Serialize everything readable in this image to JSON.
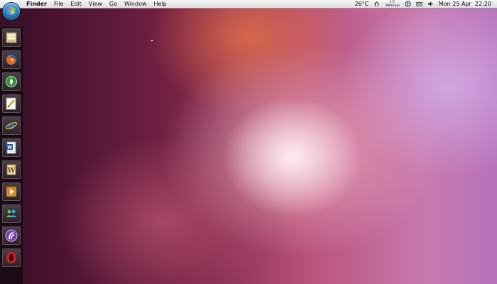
{
  "menubar": {
    "app_name": "Finder",
    "menus": [
      "File",
      "Edit",
      "View",
      "Go",
      "Window",
      "Help"
    ],
    "temperature": "26°C",
    "net_up": "1°C",
    "net_down": "3800rpm",
    "datetime": "Mon 25 Apr  22:20"
  },
  "dock": {
    "items": [
      {
        "icon": "start-orb-icon"
      },
      {
        "icon": "file-manager-icon"
      },
      {
        "icon": "firefox-icon"
      },
      {
        "icon": "green-app-icon"
      },
      {
        "icon": "text-editor-icon"
      },
      {
        "icon": "internet-explorer-icon"
      },
      {
        "icon": "word-document-icon"
      },
      {
        "icon": "wordpad-icon"
      },
      {
        "icon": "media-player-icon"
      },
      {
        "icon": "messenger-icon"
      },
      {
        "icon": "bittorrent-icon"
      },
      {
        "icon": "opera-icon"
      }
    ]
  },
  "colors": {
    "menubar": "#e8e8e8",
    "dock": "#1b0b14",
    "wallpaper_main": "#b9527a"
  }
}
